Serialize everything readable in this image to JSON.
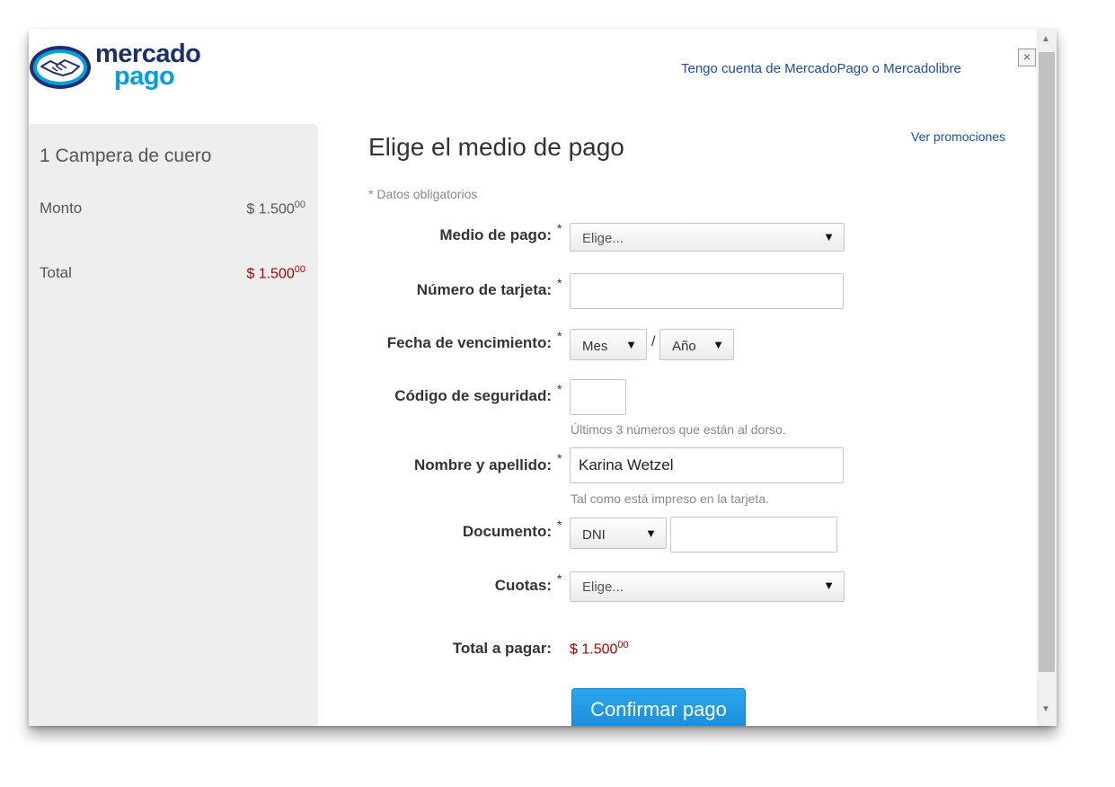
{
  "header": {
    "logo_word1": "mercado",
    "logo_word2": "pago",
    "account_link": "Tengo cuenta de MercadoPago o Mercadolibre",
    "close": "×"
  },
  "summary": {
    "product": "1 Campera de cuero",
    "amount_label": "Monto",
    "amount_main": "$ 1.500",
    "amount_cents": "00",
    "total_label": "Total",
    "total_main": "$ 1.500",
    "total_cents": "00"
  },
  "form": {
    "title": "Elige el medio de pago",
    "promo_link": "Ver promociones",
    "required_note": "* Datos obligatorios",
    "required_mark": "*",
    "payment_method": {
      "label": "Medio de pago:",
      "value": "Elige..."
    },
    "card_number": {
      "label": "Número de tarjeta:",
      "value": ""
    },
    "expiry": {
      "label": "Fecha de vencimiento:",
      "month": "Mes",
      "year": "Año",
      "separator": "/"
    },
    "security_code": {
      "label": "Código de seguridad:",
      "value": "",
      "hint": "Últimos 3 números que están al dorso."
    },
    "name": {
      "label": "Nombre y apellido:",
      "value": "Karina Wetzel",
      "hint": "Tal como está impreso en la tarjeta."
    },
    "document": {
      "label": "Documento:",
      "type": "DNI",
      "value": ""
    },
    "installments": {
      "label": "Cuotas:",
      "value": "Elige..."
    },
    "total": {
      "label": "Total a pagar:",
      "main": "$ 1.500",
      "cents": "00"
    },
    "confirm_button": "Confirmar pago"
  },
  "icons": {
    "dropdown": "▼",
    "scroll_up": "▲",
    "scroll_down": "▼"
  },
  "colors": {
    "brand_dark": "#1f2f6b",
    "brand_light": "#009ee3",
    "link": "#1a4fa3",
    "price": "#b00000",
    "button": "#1a8bd8"
  }
}
